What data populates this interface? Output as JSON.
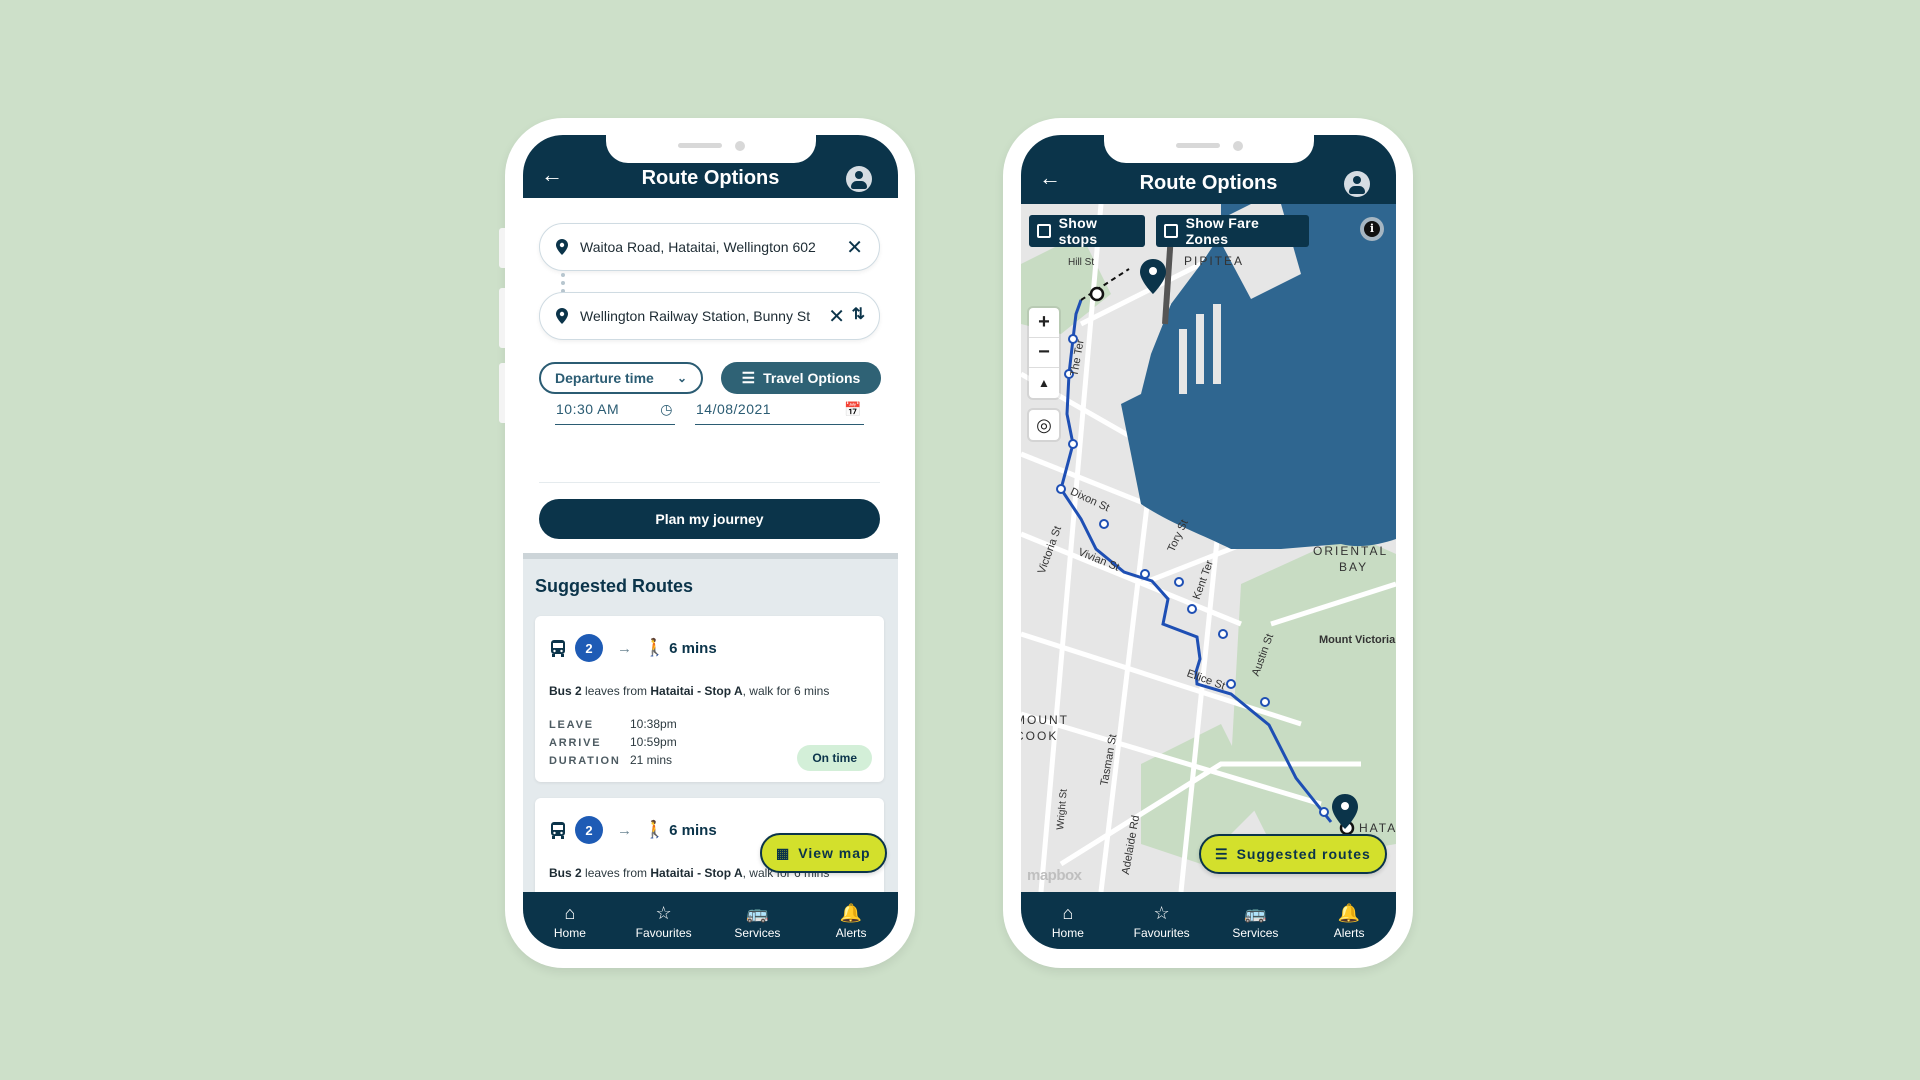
{
  "left_phone": {
    "header": {
      "title": "Route Options",
      "back_icon": "arrow-left",
      "profile_icon": "user-circle"
    },
    "origin": {
      "value": "Waitoa Road, Hataitai, Wellington 602",
      "clear_icon": "x"
    },
    "destination": {
      "value": "Wellington Railway Station, Bunny St",
      "clear_icon": "x",
      "swap_icon": "swap-vertical"
    },
    "time_mode": {
      "selected": "Departure time"
    },
    "travel_options_label": "Travel Options",
    "time_value": "10:30 AM",
    "date_value": "14/08/2021",
    "plan_button": "Plan my journey",
    "suggested_title": "Suggested Routes",
    "routes": [
      {
        "bus_number": "2",
        "walk": "6 mins",
        "desc_bus": "Bus 2",
        "desc_mid": " leaves from ",
        "desc_stop": "Hataitai - Stop A",
        "desc_end": ", walk for 6 mins",
        "leave_label": "LEAVE",
        "leave": "10:38pm",
        "arrive_label": "ARRIVE",
        "arrive": "10:59pm",
        "duration_label": "DURATION",
        "duration": "21 mins",
        "status": "On time"
      },
      {
        "bus_number": "2",
        "walk": "6 mins",
        "desc_bus": "Bus 2",
        "desc_mid": " leaves from ",
        "desc_stop": "Hataitai - Stop A",
        "desc_end": ", walk for 6 mins"
      }
    ],
    "view_map_button": "View map"
  },
  "right_phone": {
    "header": {
      "title": "Route Options"
    },
    "show_stops": {
      "label": "Show stops",
      "checked": false
    },
    "show_fare_zones": {
      "label": "Show Fare Zones",
      "checked": false
    },
    "map_labels": [
      "PIPITEA",
      "Hill St",
      "The Ter",
      "Dixon St",
      "Victoria St",
      "Vivian St",
      "Tory St",
      "Kent Ter",
      "Austin St",
      "Ellice St",
      "Tasman St",
      "Wright St",
      "Adelaide Rd",
      "ORIENTAL",
      "BAY",
      "Mount Victoria",
      "MOUNT",
      "COOK",
      "HATA"
    ],
    "attribution": "mapbox",
    "suggested_routes_button": "Suggested routes",
    "colors": {
      "water": "#2f6690",
      "route": "#1e4fb4",
      "land": "#e8e8e8",
      "park": "#c5dcc0"
    }
  },
  "tabbar": [
    {
      "label": "Home",
      "icon": "home"
    },
    {
      "label": "Favourites",
      "icon": "star"
    },
    {
      "label": "Services",
      "icon": "bus"
    },
    {
      "label": "Alerts",
      "icon": "bell"
    }
  ],
  "colors": {
    "navy": "#0b344a",
    "accent_yellow": "#d3e02c",
    "bus_badge": "#1e5bb5",
    "ontime_bg": "#d3efd8",
    "background": "#cde0c9"
  }
}
